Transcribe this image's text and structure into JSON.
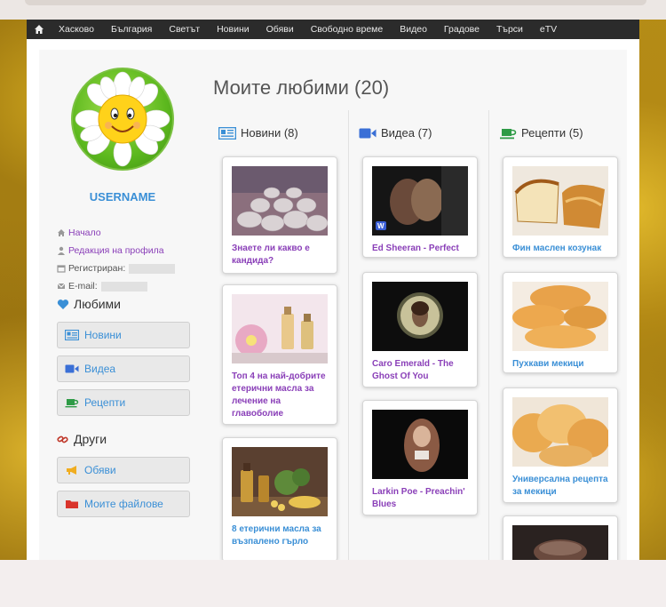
{
  "navbar": {
    "items": [
      "Хасково",
      "България",
      "Светът",
      "Новини",
      "Обяви",
      "Свободно време",
      "Видео",
      "Градове",
      "Търси",
      "eTV"
    ]
  },
  "profile": {
    "username": "USERNAME",
    "links": {
      "home": "Начало",
      "edit_profile": "Редакция на профила",
      "registered": "Регистриран:",
      "email": "E-mail:"
    }
  },
  "sidebar": {
    "favorites_title": "Любими",
    "favorites": [
      "Новини",
      "Видеа",
      "Рецепти"
    ],
    "other_title": "Други",
    "other": [
      "Обяви",
      "Моите файлове"
    ]
  },
  "main": {
    "title": "Моите любими (20)",
    "columns": {
      "news": {
        "header": "Новини (8)",
        "items": [
          "Знаете ли какво е кандида?",
          "Топ 4 на най-добрите етерични масла за лечение на главоболие",
          "8 етерични масла за възпалено гърло"
        ]
      },
      "videos": {
        "header": "Видеа (7)",
        "items": [
          "Ed Sheeran - Perfect",
          "Caro Emerald - The Ghost Of You",
          "Larkin Poe - Preachin' Blues"
        ]
      },
      "recipes": {
        "header": "Рецепти (5)",
        "items": [
          "Фин маслен козунак",
          "Пухкави мекици",
          "Универсална рецепта за мекици"
        ]
      }
    }
  },
  "colors": {
    "nav_bg": "#2b2b2b",
    "link_blue": "#3a8fd6",
    "link_purple": "#8a3fb8",
    "recipe_green": "#2e9b46"
  }
}
